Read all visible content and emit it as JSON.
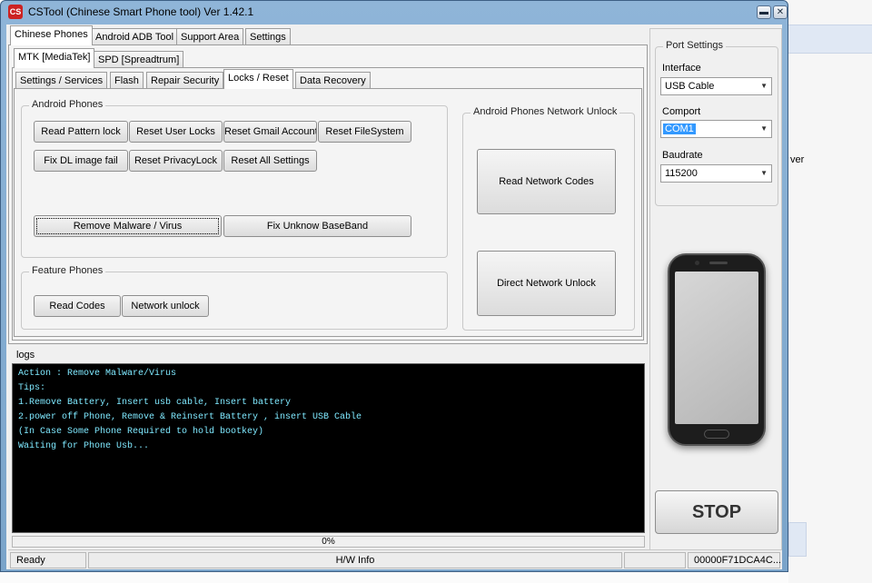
{
  "window": {
    "title": "CSTool (Chinese Smart Phone tool)  Ver 1.42.1",
    "icon": "app-icon",
    "controls": [
      "minimize-icon",
      "close-icon"
    ]
  },
  "background": {
    "fragment_text": "ver"
  },
  "main_tabs": [
    "Chinese Phones",
    "Android ADB Tool",
    "Support Area",
    "Settings"
  ],
  "chip_tabs": [
    "MTK [MediaTek]",
    "SPD [Spreadtrum]"
  ],
  "sub_tabs": [
    "Settings / Services",
    "Flash",
    "Repair Security",
    "Locks / Reset",
    "Data Recovery"
  ],
  "android_phones": {
    "title": "Android Phones",
    "buttons": {
      "read_pattern_lock": "Read Pattern lock",
      "reset_user_locks": "Reset User Locks",
      "reset_gmail_account": "Reset Gmail Account",
      "reset_filesystem": "Reset FileSystem",
      "fix_dl_image_fail": "Fix DL image fail",
      "reset_privacylock": "Reset PrivacyLock",
      "reset_all_settings": "Reset All Settings",
      "remove_malware_virus": "Remove Malware / Virus",
      "fix_unknow_baseband": "Fix Unknow BaseBand"
    }
  },
  "feature_phones": {
    "title": "Feature Phones",
    "buttons": {
      "read_codes": "Read Codes",
      "network_unlock": "Network unlock"
    }
  },
  "network_unlock": {
    "title": "Android Phones Network Unlock",
    "buttons": {
      "read_network_codes": "Read Network Codes",
      "direct_network_unlock": "Direct Network Unlock"
    }
  },
  "port_settings": {
    "title": "Port Settings",
    "interface_label": "Interface",
    "interface_value": "USB Cable",
    "comport_label": "Comport",
    "comport_value": "COM1",
    "baudrate_label": "Baudrate",
    "baudrate_value": "115200"
  },
  "logs": {
    "label": "logs",
    "lines": [
      "Action : Remove Malware/Virus",
      "Tips:",
      "1.Remove Battery, Insert usb cable, Insert battery",
      "2.power off Phone, Remove & Reinsert Battery , insert USB Cable",
      "(In Case Some Phone Required to hold bootkey)",
      "Waiting for Phone Usb..."
    ],
    "text_color": "#7fe9ff"
  },
  "progress": {
    "text": "0%",
    "value": 0
  },
  "stop_label": "STOP",
  "status": {
    "state": "Ready",
    "hw_info": "H/W Info",
    "serial": "00000F71DCA4C..."
  }
}
